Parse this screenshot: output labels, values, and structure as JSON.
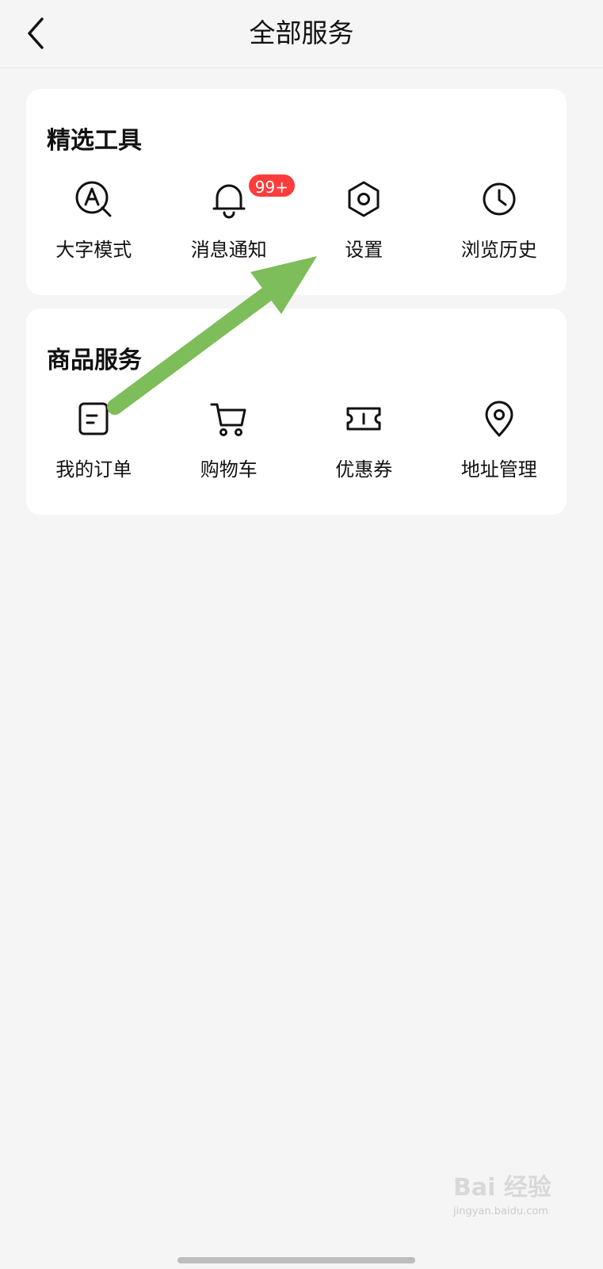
{
  "header": {
    "title": "全部服务",
    "back_icon": "chevron-left-icon"
  },
  "sections": [
    {
      "title": "精选工具",
      "items": [
        {
          "label": "大字模式",
          "icon": "large-text-icon"
        },
        {
          "label": "消息通知",
          "icon": "bell-icon",
          "badge": "99+"
        },
        {
          "label": "设置",
          "icon": "settings-hexagon-icon"
        },
        {
          "label": "浏览历史",
          "icon": "clock-icon"
        }
      ]
    },
    {
      "title": "商品服务",
      "items": [
        {
          "label": "我的订单",
          "icon": "order-list-icon"
        },
        {
          "label": "购物车",
          "icon": "cart-icon"
        },
        {
          "label": "优惠券",
          "icon": "ticket-icon"
        },
        {
          "label": "地址管理",
          "icon": "location-pin-icon"
        }
      ]
    }
  ],
  "annotation": {
    "arrow_color": "#7dbd5a"
  },
  "watermark": {
    "brand": "Bai  经验",
    "url": "jingyan.baidu.com"
  },
  "colors": {
    "background": "#f5f5f5",
    "card": "#ffffff",
    "badge": "#ff3b3b"
  }
}
